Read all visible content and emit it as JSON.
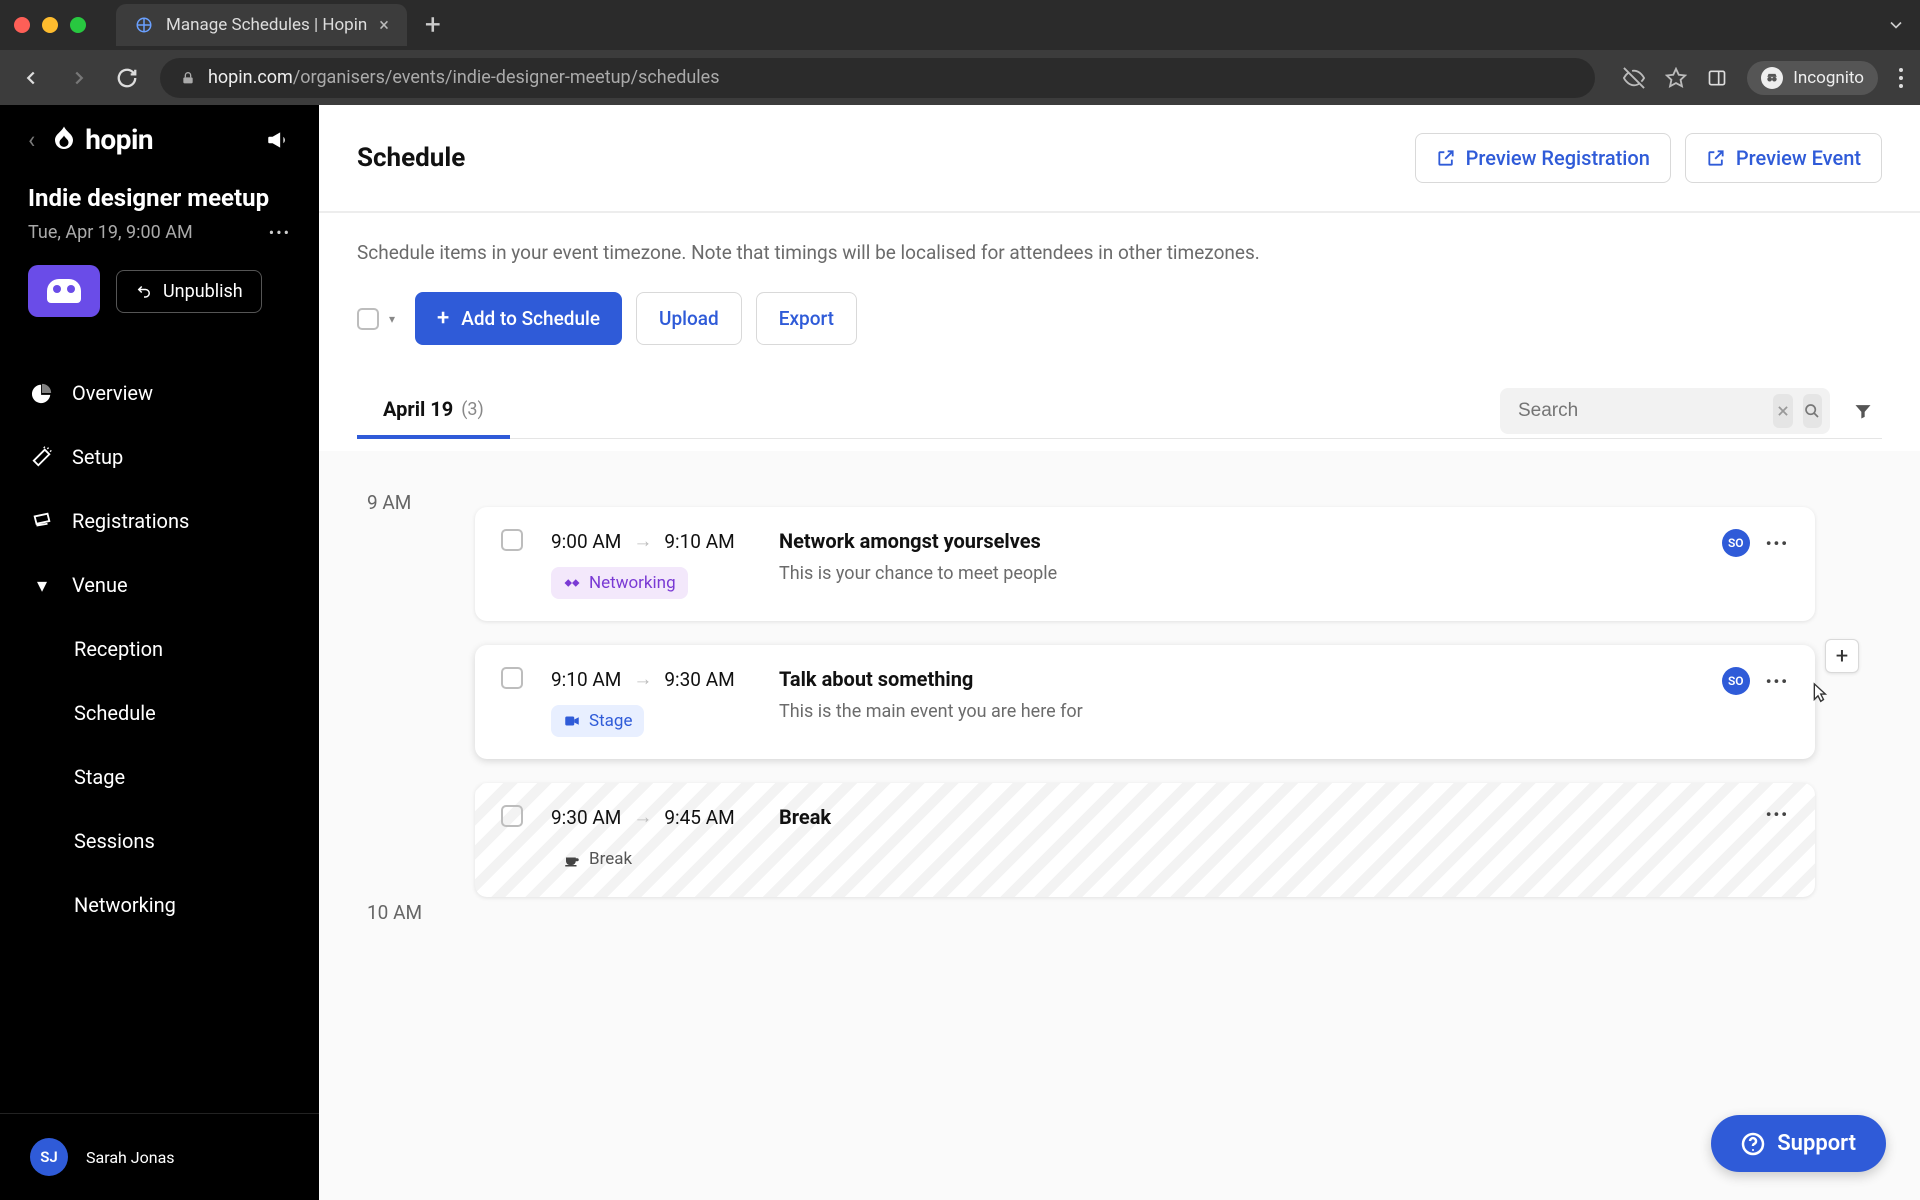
{
  "browser": {
    "tab_title": "Manage Schedules | Hopin",
    "url_host": "hopin.com",
    "url_path": "/organisers/events/indie-designer-meetup/schedules",
    "incognito_label": "Incognito"
  },
  "sidebar": {
    "logo_text": "hopin",
    "event_title": "Indie designer meetup",
    "event_subtitle": "Tue, Apr 19, 9:00 AM",
    "unpublish_label": "Unpublish",
    "nav": {
      "overview": "Overview",
      "setup": "Setup",
      "registrations": "Registrations",
      "venue": "Venue",
      "reception": "Reception",
      "schedule": "Schedule",
      "stage": "Stage",
      "sessions": "Sessions",
      "networking": "Networking"
    },
    "user": {
      "initials": "SJ",
      "name": "Sarah Jonas"
    }
  },
  "header": {
    "page_title": "Schedule",
    "preview_registration": "Preview Registration",
    "preview_event": "Preview Event"
  },
  "content": {
    "description": "Schedule items in your event timezone. Note that timings will be localised for attendees in other timezones.",
    "add_button": "Add to Schedule",
    "upload_button": "Upload",
    "export_button": "Export",
    "date_tab_label": "April 19",
    "date_tab_count": "(3)",
    "search_placeholder": "Search",
    "time_labels": {
      "nine": "9 AM",
      "ten": "10 AM"
    },
    "sessions": [
      {
        "start": "9:00 AM",
        "end": "9:10 AM",
        "tag": "Networking",
        "title": "Network amongst yourselves",
        "desc": "This is your chance to meet people",
        "badge": "SO"
      },
      {
        "start": "9:10 AM",
        "end": "9:30 AM",
        "tag": "Stage",
        "title": "Talk about something",
        "desc": "This is the main event you are here for",
        "badge": "SO"
      },
      {
        "start": "9:30 AM",
        "end": "9:45 AM",
        "tag": "Break",
        "title": "Break",
        "desc": ""
      }
    ]
  },
  "support_label": "Support"
}
